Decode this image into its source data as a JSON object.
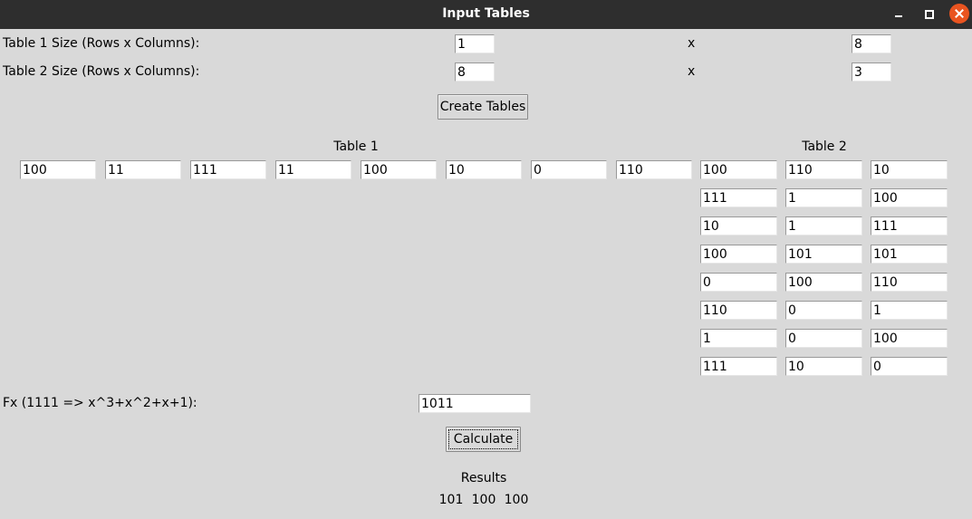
{
  "window": {
    "title": "Input Tables"
  },
  "size": {
    "t1_label": "Table 1 Size (Rows x Columns):",
    "t1_rows": "1",
    "t1_cols": "8",
    "t2_label": "Table 2 Size (Rows x Columns):",
    "t2_rows": "8",
    "t2_cols": "3",
    "x": "x"
  },
  "create_button": "Create Tables",
  "table1": {
    "title": "Table 1",
    "cells": [
      "100",
      "11",
      "111",
      "11",
      "100",
      "10",
      "0",
      "110"
    ]
  },
  "table2": {
    "title": "Table 2",
    "rows": [
      [
        "100",
        "110",
        "10"
      ],
      [
        "111",
        "1",
        "100"
      ],
      [
        "10",
        "1",
        "111"
      ],
      [
        "100",
        "101",
        "101"
      ],
      [
        "0",
        "100",
        "110"
      ],
      [
        "110",
        "0",
        "1"
      ],
      [
        "1",
        "0",
        "100"
      ],
      [
        "111",
        "10",
        "0"
      ]
    ]
  },
  "fx": {
    "label": "Fx (1111 => x^3+x^2+x+1):",
    "value": "1011"
  },
  "calculate_button": "Calculate",
  "results": {
    "title": "Results",
    "values": [
      "101",
      "100",
      "100"
    ]
  }
}
